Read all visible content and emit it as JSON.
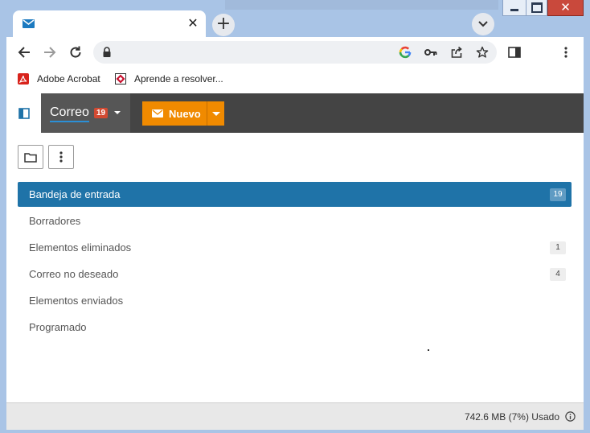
{
  "browser": {
    "tab": {
      "icon": "mail-icon",
      "title": ""
    },
    "address": {
      "url": ""
    },
    "bookmarks": [
      {
        "label": "Adobe Acrobat",
        "icon": "acrobat-icon"
      },
      {
        "label": "Aprende a resolver...",
        "icon": "bookmark-site-icon"
      }
    ]
  },
  "app": {
    "header": {
      "mail_label": "Correo",
      "mail_badge": "19",
      "new_label": "Nuevo"
    },
    "folders": [
      {
        "label": "Bandeja de entrada",
        "count": "19",
        "selected": true
      },
      {
        "label": "Borradores",
        "count": ""
      },
      {
        "label": "Elementos eliminados",
        "count": "1"
      },
      {
        "label": "Correo no deseado",
        "count": "4"
      },
      {
        "label": "Elementos enviados",
        "count": ""
      },
      {
        "label": "Programado",
        "count": ""
      }
    ],
    "status": {
      "usage": "742.6 MB (7%) Usado"
    }
  },
  "colors": {
    "accent_orange": "#f08a00",
    "selected_blue": "#1f73a8",
    "badge_red": "#d24a32",
    "header_dark": "#444444"
  }
}
